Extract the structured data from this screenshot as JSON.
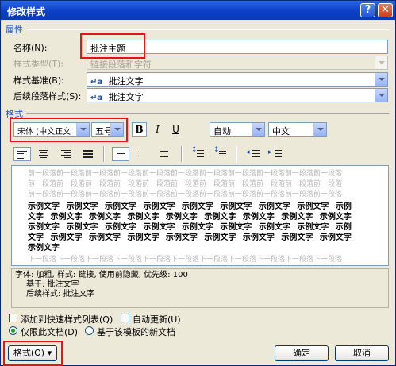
{
  "window": {
    "title": "修改样式",
    "help_glyph": "?",
    "close_glyph": "✕"
  },
  "properties": {
    "section_label": "属性",
    "name_label": "名称(N):",
    "name_value": "批注主题",
    "style_type_label": "样式类型(T):",
    "style_type_value": "链接段落和字符",
    "based_on_label": "样式基准(B):",
    "based_on_value": "批注文字",
    "next_style_label": "后续段落样式(S):",
    "next_style_value": "批注文字",
    "para_icon": "↵a"
  },
  "format": {
    "section_label": "格式",
    "font_name": "宋体 (中文正文",
    "font_size": "五号",
    "bold_label": "B",
    "italic_label": "I",
    "underline_label": "U",
    "color_value": "自动",
    "language_value": "中文"
  },
  "preview": {
    "prev_text": "前一段落前一段落前一段落前一段落前一段落前一段落前一段落前一段落前一段落前一段落前一段落",
    "sample_lines": [
      "示例文字 示例文字 示例文字 示例文字 示例文字 示例文字 示例文字 示例文字 示例",
      "文字 示例文字 示例文字 示例文字 示例文字 示例文字 示例文字 示例文字 示例文字",
      "示例文字 示例文字 示例文字 示例文字 示例文字 示例文字 示例文字 示例文字 示例",
      "文字 示例文字 示例文字 示例文字 示例文字 示例文字 示例文字 示例文字 示例文字",
      "示例文字"
    ],
    "next_text": "下一段落下一段落下一段落下一段落下一段落下一段落下一段落下一段落下一段落下一段落下一段落"
  },
  "description": {
    "line1": "字体: 加粗, 样式: 链接, 使用前隐藏, 优先级: 100",
    "line2": "基于: 批注文字",
    "line3": "后续样式: 批注文字"
  },
  "options": {
    "add_quick_label": "添加到快速样式列表(Q)",
    "auto_update_label": "自动更新(U)",
    "only_doc_label": "仅限此文档(D)",
    "template_label": "基于该模板的新文档"
  },
  "buttons": {
    "format_label": "格式(O) ▾",
    "ok_label": "确定",
    "cancel_label": "取消"
  },
  "colors": {
    "highlight": "#e8121b",
    "title_bar": "#0a3fc7",
    "section": "#2151c7"
  }
}
